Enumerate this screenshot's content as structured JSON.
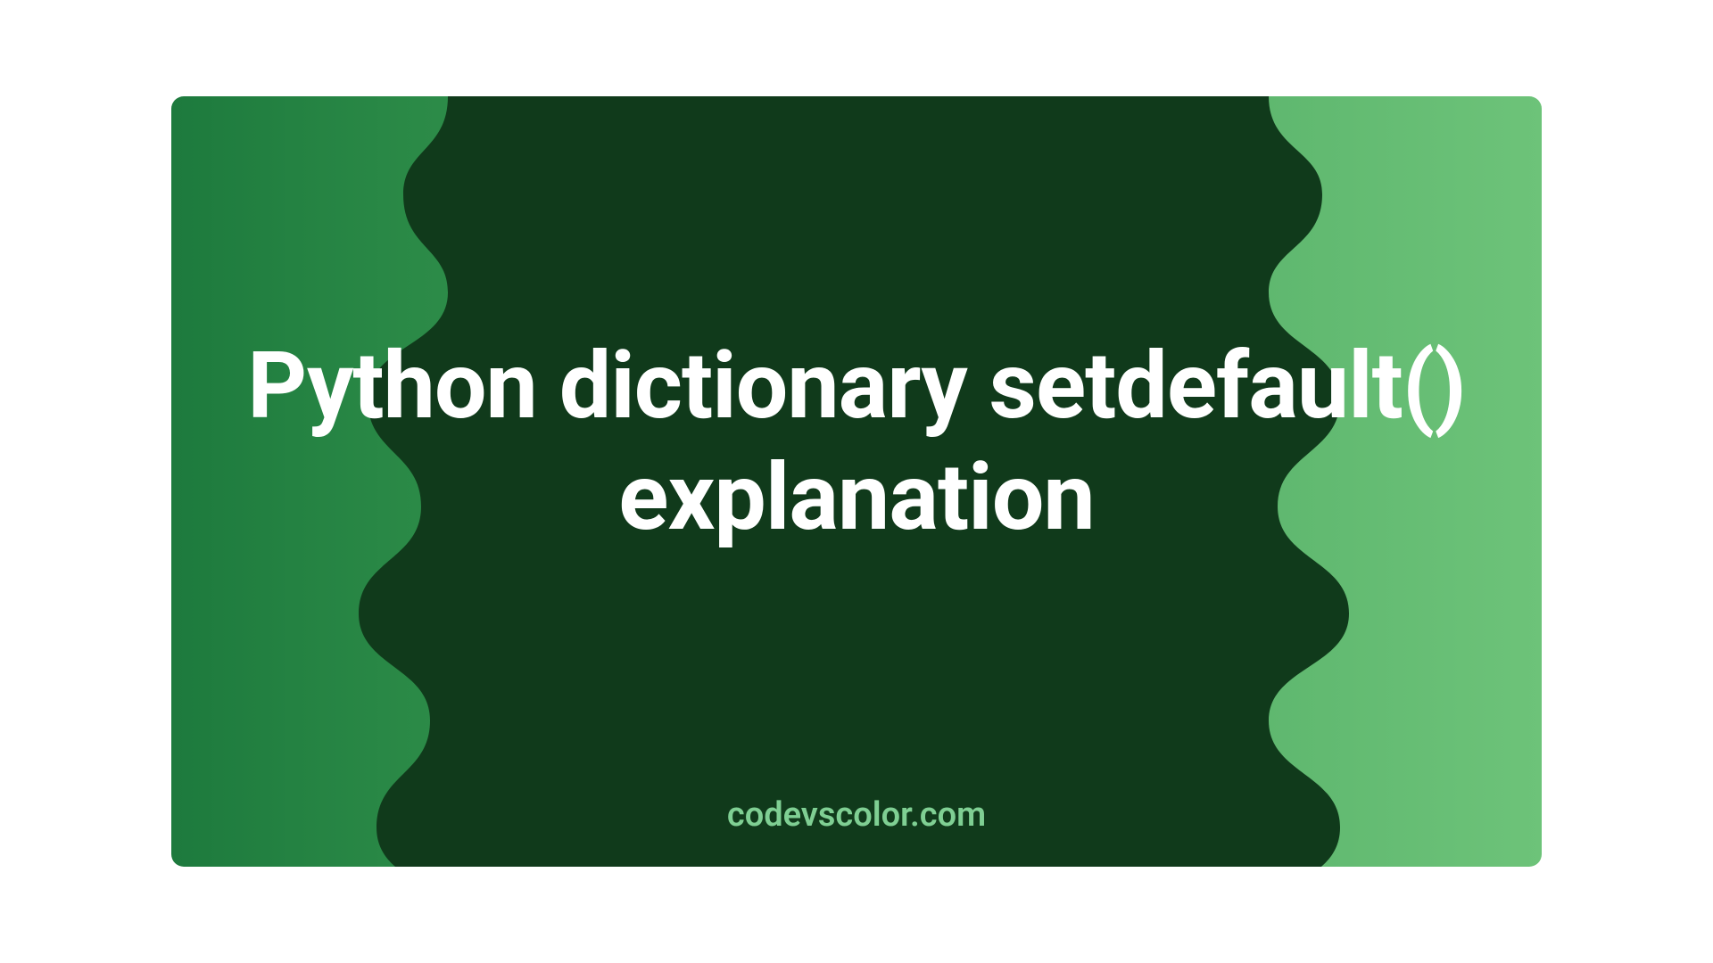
{
  "title": "Python dictionary setdefault() explanation",
  "footer": "codevscolor.com",
  "colors": {
    "blob": "#103a1b",
    "bg_left": "#1d7a3d",
    "bg_right": "#6dc379",
    "title_text": "#ffffff",
    "footer_text": "#7fcf93"
  }
}
